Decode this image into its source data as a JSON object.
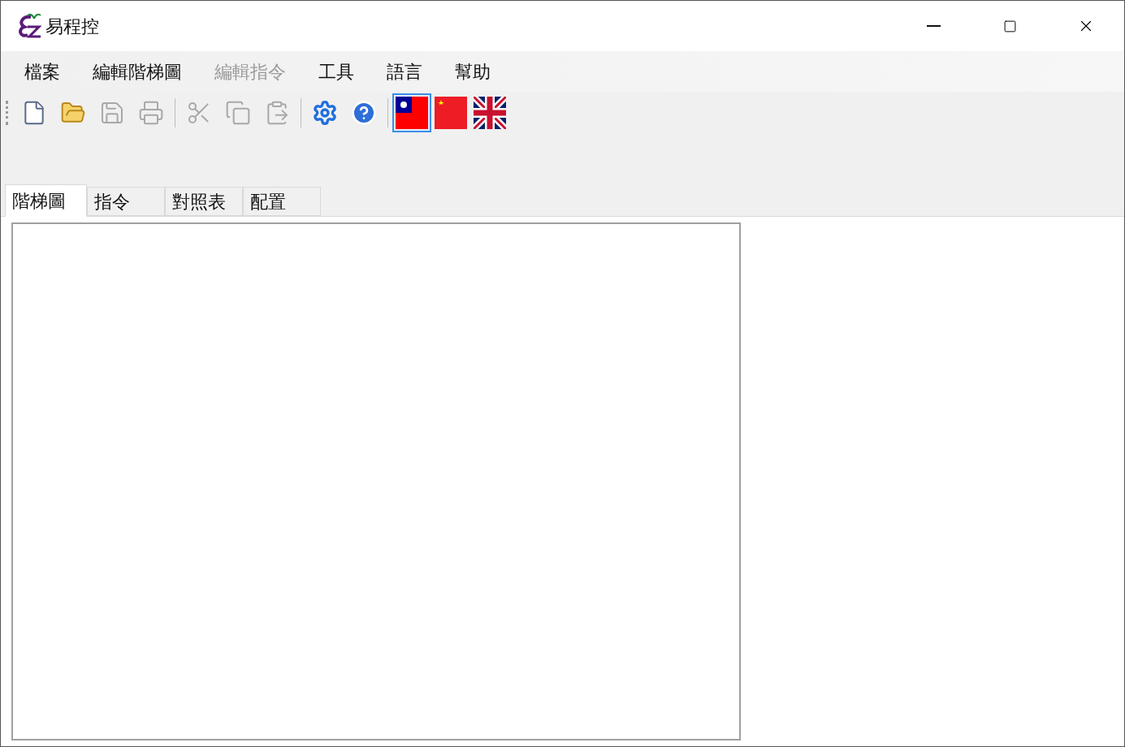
{
  "window": {
    "title": "易程控"
  },
  "menu": [
    {
      "label": "檔案",
      "disabled": false
    },
    {
      "label": "編輯階梯圖",
      "disabled": false
    },
    {
      "label": "編輯指令",
      "disabled": true
    },
    {
      "label": "工具",
      "disabled": false
    },
    {
      "label": "語言",
      "disabled": false
    },
    {
      "label": "幫助",
      "disabled": false
    }
  ],
  "toolbar": [
    {
      "kind": "new",
      "disabled": false,
      "selected": false
    },
    {
      "kind": "open",
      "disabled": false,
      "selected": false
    },
    {
      "kind": "save",
      "disabled": true,
      "selected": false
    },
    {
      "kind": "print",
      "disabled": true,
      "selected": false
    },
    {
      "kind": "separator"
    },
    {
      "kind": "cut",
      "disabled": true,
      "selected": false
    },
    {
      "kind": "copy",
      "disabled": true,
      "selected": false
    },
    {
      "kind": "paste",
      "disabled": true,
      "selected": false
    },
    {
      "kind": "separator"
    },
    {
      "kind": "settings",
      "disabled": false,
      "selected": false
    },
    {
      "kind": "help",
      "disabled": false,
      "selected": false
    },
    {
      "kind": "separator"
    },
    {
      "kind": "tw",
      "selected": true
    },
    {
      "kind": "cn",
      "selected": false
    },
    {
      "kind": "uk",
      "selected": false
    }
  ],
  "tabs": [
    {
      "label": "階梯圖",
      "selected": true
    },
    {
      "label": "指令",
      "selected": false
    },
    {
      "label": "對照表",
      "selected": false
    },
    {
      "label": "配置",
      "selected": false
    }
  ]
}
